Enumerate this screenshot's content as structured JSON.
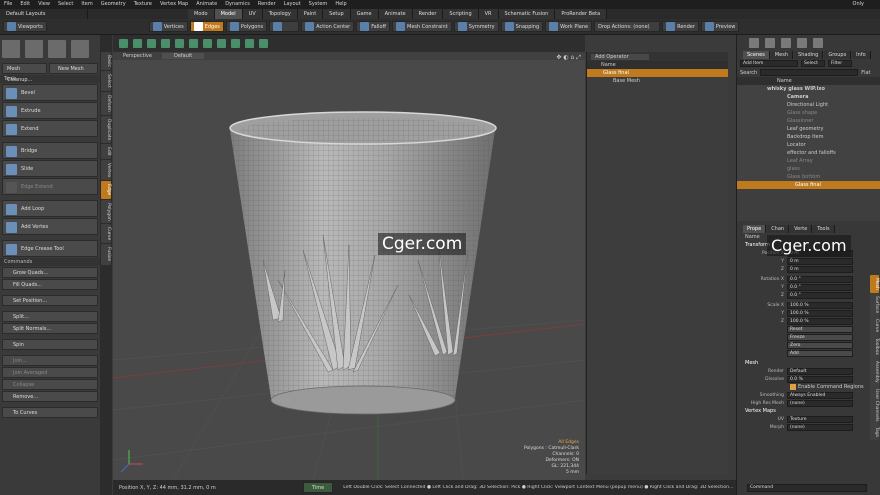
{
  "menubar": {
    "items": [
      "File",
      "Edit",
      "View",
      "Select",
      "Item",
      "Geometry",
      "Texture",
      "Vertex Map",
      "Animate",
      "Dynamics",
      "Render",
      "Layout",
      "System",
      "Help"
    ],
    "right": "Only"
  },
  "layoutbar": {
    "layout_name": "Default Layouts",
    "tabs": [
      "Modo",
      "Model",
      "UV",
      "Topology",
      "Paint",
      "Setup",
      "Game",
      "Animate",
      "Render",
      "Scripting",
      "VR",
      "Schematic Fusion",
      "ProRender Beta"
    ],
    "active_tab": "Model"
  },
  "toolbar": {
    "viewports_label": "Viewports",
    "vertices": "Vertices",
    "edges": "Edges",
    "polygons": "Polygons",
    "action_center": "Action Center",
    "falloff": "Falloff",
    "mesh_constraint": "Mesh Constraint",
    "symmetry": "Symmetry",
    "snapping": "Snapping",
    "work_plane": "Work Plane",
    "drop_actions": "Drop Actions: (none)",
    "render": "Render",
    "preview": "Preview"
  },
  "left_panel": {
    "mesh_cleanup": "Mesh Cleanup...",
    "new_mesh": "New Mesh",
    "tools_header": "Tools",
    "tools": [
      {
        "label": "Bevel",
        "big": true
      },
      {
        "label": "Extrude",
        "big": true
      },
      {
        "label": "Extend",
        "big": true
      },
      {
        "label": "Bridge",
        "big": true
      },
      {
        "label": "Slide",
        "big": true
      },
      {
        "label": "Edge Extend",
        "big": true,
        "disabled": true
      },
      {
        "label": "Add Loop",
        "big": true
      },
      {
        "label": "Add Vertex",
        "big": true
      },
      {
        "label": "Edge Crease Tool",
        "big": true
      }
    ],
    "commands_header": "Commands",
    "commands": [
      {
        "label": "Grow Quads..."
      },
      {
        "label": "Fill Quads..."
      },
      {
        "label": "Set Position..."
      },
      {
        "label": "Split..."
      },
      {
        "label": "Split Normals..."
      },
      {
        "label": "Spin"
      },
      {
        "label": "Join..."
      },
      {
        "label": "Join Averaged",
        "disabled": true
      },
      {
        "label": "Collapse",
        "disabled": true
      },
      {
        "label": "Remove..."
      },
      {
        "label": "To Curves"
      }
    ]
  },
  "vertical_tabs": [
    "Basic",
    "Select",
    "Deform",
    "Duplicate",
    "Edit",
    "Vertex",
    "Edge",
    "Polygon",
    "Curve",
    "Fusion"
  ],
  "active_vertical_tab": "Edge",
  "viewport": {
    "view": "Perspective",
    "shading": "Default",
    "info_lines": [
      "All Edges",
      "Polygons : Catmull-Clark",
      "Channels: 0",
      "Deformers: ON",
      "GL: 221,344",
      "5 mm"
    ],
    "watermark": "Cger.com"
  },
  "operator_panel": {
    "add_operator": "Add Operator",
    "header": "Name",
    "items": [
      "Glass final",
      "Base Mesh"
    ]
  },
  "right_panel": {
    "top_tabs": [
      "Scenes",
      "Mesh",
      "Shading",
      "Groups",
      "Info"
    ],
    "add_item": "Add Item",
    "select": "Select",
    "filter": "Filter",
    "search_label": "Search",
    "flat": "Flat",
    "name_header": "Name",
    "items": [
      {
        "label": "whisky glass WIP.lxo",
        "level": 0,
        "bold": true
      },
      {
        "label": "Camera",
        "level": 1,
        "bold": true
      },
      {
        "label": "Directional Light",
        "level": 1
      },
      {
        "label": "Glass shape",
        "level": 1,
        "dim": true
      },
      {
        "label": "Glassinner",
        "level": 1,
        "dim": true
      },
      {
        "label": "Leaf geometry",
        "level": 1
      },
      {
        "label": "Backdrop Item",
        "level": 1
      },
      {
        "label": "Locator",
        "level": 1
      },
      {
        "label": "effector and falloffs",
        "level": 1
      },
      {
        "label": "Leaf Array",
        "level": 1,
        "dim": true
      },
      {
        "label": "glass",
        "level": 1,
        "dim": true
      },
      {
        "label": "Glass bottom",
        "level": 1,
        "dim": true
      },
      {
        "label": "Glass final",
        "level": 1,
        "selected": true
      }
    ],
    "prop_tabs": [
      "Prope",
      "Chan",
      "Verte",
      "Tools"
    ],
    "side_tabs": [
      "Mesh",
      "Surface",
      "Curve",
      "Toolbox",
      "Assembly",
      "User Channels",
      "Tags"
    ],
    "name_label": "Name",
    "transform_header": "Transform",
    "position_label": "Position X",
    "position": [
      "0 m",
      "0 m",
      "0 m"
    ],
    "rotation_label": "Rotation X",
    "rotation": [
      "0.0 °",
      "0.0 °",
      "0.0 °"
    ],
    "scale_label": "Scale X",
    "scale": [
      "100.0 %",
      "100.0 %",
      "100.0 %"
    ],
    "axis_y": "Y",
    "axis_z": "Z",
    "transform_actions": [
      "Reset",
      "Freeze",
      "Zero",
      "Add"
    ],
    "mesh_header": "Mesh",
    "render_label": "Render",
    "render_value": "Default",
    "dissolve_label": "Dissolve",
    "dissolve_value": "0.0 %",
    "enable_regions": "Enable Command Regions",
    "smoothing_label": "Smoothing",
    "smoothing_value": "Always Enabled",
    "highres_label": "High Res Mesh",
    "highres_value": "(none)",
    "vertex_maps_header": "Vertex Maps",
    "uv_label": "UV",
    "uv_value": "Texture",
    "morph_label": "Morph",
    "morph_value": "(none)",
    "command_placeholder": "Command"
  },
  "statusbar": {
    "position": "Position X, Y, Z:  44 mm, 31.2 mm, 0 m",
    "time": "Time",
    "hint": "Left Double Click: Select Connected ● Left Click and Drag: 3D Selection: Pick ● Right Click: Viewport Context Menu (popup menu) ● Right Click and Drag: 3D Selection..."
  }
}
